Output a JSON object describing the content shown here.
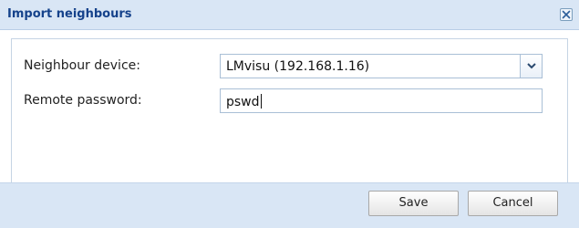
{
  "dialog": {
    "title": "Import neighbours",
    "close_icon": "close-icon"
  },
  "form": {
    "device_label": "Neighbour device:",
    "device_value": "LMvisu (192.168.1.16)",
    "device_dropdown_icon": "chevron-down-icon",
    "password_label": "Remote password:",
    "password_value": "pswd"
  },
  "buttons": {
    "save_label": "Save",
    "cancel_label": "Cancel"
  },
  "colors": {
    "title_bar": "#d9e6f5",
    "title_text": "#15428b",
    "footer": "#d9e6f5"
  }
}
